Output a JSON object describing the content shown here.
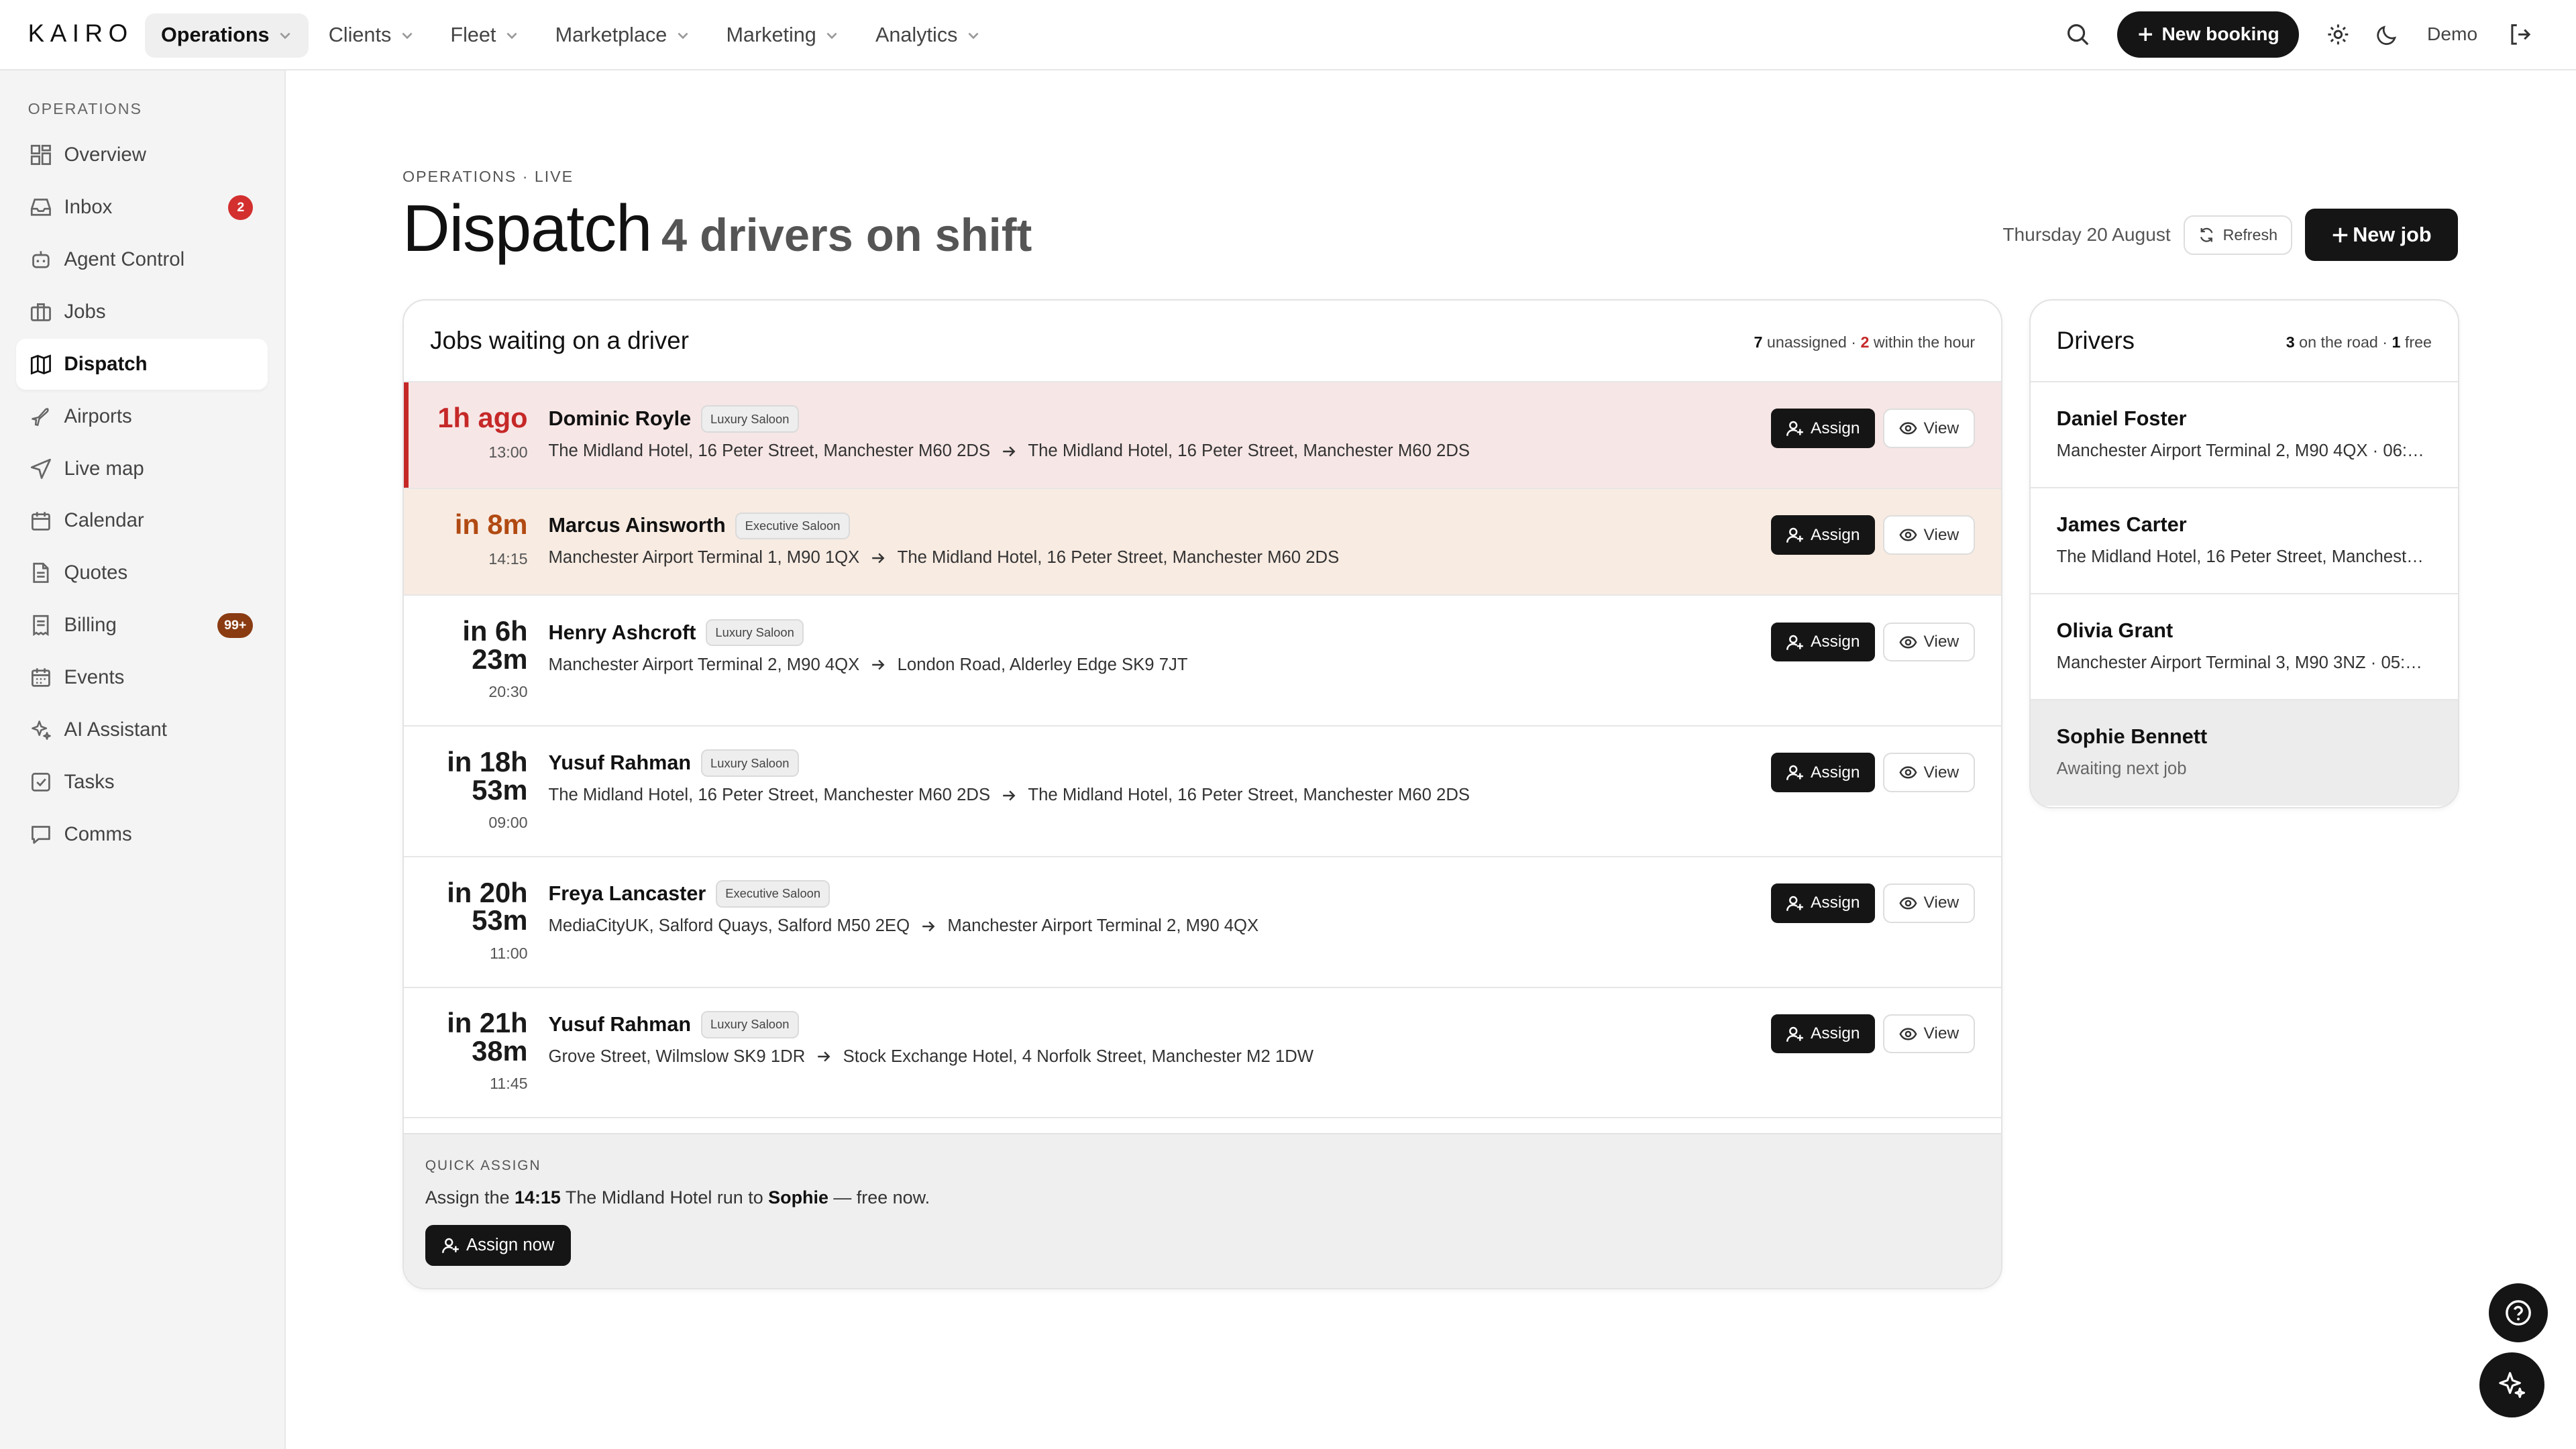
{
  "app": {
    "logo": "KAIRO"
  },
  "nav": [
    {
      "label": "Operations",
      "active": true
    },
    {
      "label": "Clients"
    },
    {
      "label": "Fleet"
    },
    {
      "label": "Marketplace"
    },
    {
      "label": "Marketing"
    },
    {
      "label": "Analytics"
    }
  ],
  "topbar": {
    "new_booking": "New booking",
    "user": "Demo"
  },
  "sidebar": {
    "heading": "OPERATIONS",
    "items": [
      {
        "label": "Overview",
        "icon": "grid-icon"
      },
      {
        "label": "Inbox",
        "icon": "inbox-icon",
        "badge": "2",
        "badge_color": "#d32f2f"
      },
      {
        "label": "Agent Control",
        "icon": "bot-icon"
      },
      {
        "label": "Jobs",
        "icon": "briefcase-icon"
      },
      {
        "label": "Dispatch",
        "icon": "map-icon",
        "active": true
      },
      {
        "label": "Airports",
        "icon": "plane-icon"
      },
      {
        "label": "Live map",
        "icon": "navigation-icon"
      },
      {
        "label": "Calendar",
        "icon": "calendar-icon"
      },
      {
        "label": "Quotes",
        "icon": "file-text-icon"
      },
      {
        "label": "Billing",
        "icon": "receipt-icon",
        "badge": "99+",
        "badge_color": "#8a3b12"
      },
      {
        "label": "Events",
        "icon": "calendar-days-icon"
      },
      {
        "label": "AI Assistant",
        "icon": "sparkles-icon"
      },
      {
        "label": "Tasks",
        "icon": "check-square-icon"
      },
      {
        "label": "Comms",
        "icon": "message-icon"
      }
    ]
  },
  "page": {
    "breadcrumb": "OPERATIONS · LIVE",
    "title": "Dispatch",
    "subtitle": "4 drivers on shift",
    "date": "Thursday 20 August",
    "refresh": "Refresh",
    "new_job": "New job"
  },
  "jobs_card": {
    "title": "Jobs waiting on a driver",
    "unassigned_count": "7",
    "unassigned_label": " unassigned · ",
    "within_count": "2",
    "within_label": " within the hour",
    "assign_label": "Assign",
    "view_label": "View",
    "jobs": [
      {
        "when1": "1h ago",
        "when2": "",
        "time": "13:00",
        "name": "Dominic Royle",
        "vehicle": "Luxury Saloon",
        "from": "The Midland Hotel, 16 Peter Street, Manchester M60 2DS",
        "to": "The Midland Hotel, 16 Peter Street, Manchester M60 2DS",
        "state": "overdue"
      },
      {
        "when1": "in 8m",
        "when2": "",
        "time": "14:15",
        "name": "Marcus Ainsworth",
        "vehicle": "Executive Saloon",
        "from": "Manchester Airport Terminal 1, M90 1QX",
        "to": "The Midland Hotel, 16 Peter Street, Manchester M60 2DS",
        "state": "soon"
      },
      {
        "when1": "in 6h",
        "when2": "23m",
        "time": "20:30",
        "name": "Henry Ashcroft",
        "vehicle": "Luxury Saloon",
        "from": "Manchester Airport Terminal 2, M90 4QX",
        "to": "London Road, Alderley Edge SK9 7JT",
        "state": "normal"
      },
      {
        "when1": "in 18h",
        "when2": "53m",
        "time": "09:00",
        "name": "Yusuf Rahman",
        "vehicle": "Luxury Saloon",
        "from": "The Midland Hotel, 16 Peter Street, Manchester M60 2DS",
        "to": "The Midland Hotel, 16 Peter Street, Manchester M60 2DS",
        "state": "normal"
      },
      {
        "when1": "in 20h",
        "when2": "53m",
        "time": "11:00",
        "name": "Freya Lancaster",
        "vehicle": "Executive Saloon",
        "from": "MediaCityUK, Salford Quays, Salford M50 2EQ",
        "to": "Manchester Airport Terminal 2, M90 4QX",
        "state": "normal"
      },
      {
        "when1": "in 21h",
        "when2": "38m",
        "time": "11:45",
        "name": "Yusuf Rahman",
        "vehicle": "Luxury Saloon",
        "from": "Grove Street, Wilmslow SK9 1DR",
        "to": "Stock Exchange Hotel, 4 Norfolk Street, Manchester M2 1DW",
        "state": "normal"
      }
    ]
  },
  "quick_assign": {
    "label": "QUICK ASSIGN",
    "text_prefix": "Assign the ",
    "time": "14:15",
    "text_mid": " The Midland Hotel run to ",
    "driver": "Sophie",
    "text_suffix": " — free now.",
    "button": "Assign now"
  },
  "drivers_card": {
    "title": "Drivers",
    "road_count": "3",
    "road_label": " on the road · ",
    "free_count": "1",
    "free_label": " free",
    "drivers": [
      {
        "name": "Daniel Foster",
        "status": "Manchester Airport Terminal 2, M90 4QX · 06:…",
        "free": false
      },
      {
        "name": "James Carter",
        "status": "The Midland Hotel, 16 Peter Street, Mancheste…",
        "free": false
      },
      {
        "name": "Olivia Grant",
        "status": "Manchester Airport Terminal 3, M90 3NZ · 05:…",
        "free": false
      },
      {
        "name": "Sophie Bennett",
        "status": "Awaiting next job",
        "free": true
      }
    ]
  },
  "fabs": {
    "help_icon": "help-circle-icon",
    "ai_icon": "sparkles-icon"
  }
}
